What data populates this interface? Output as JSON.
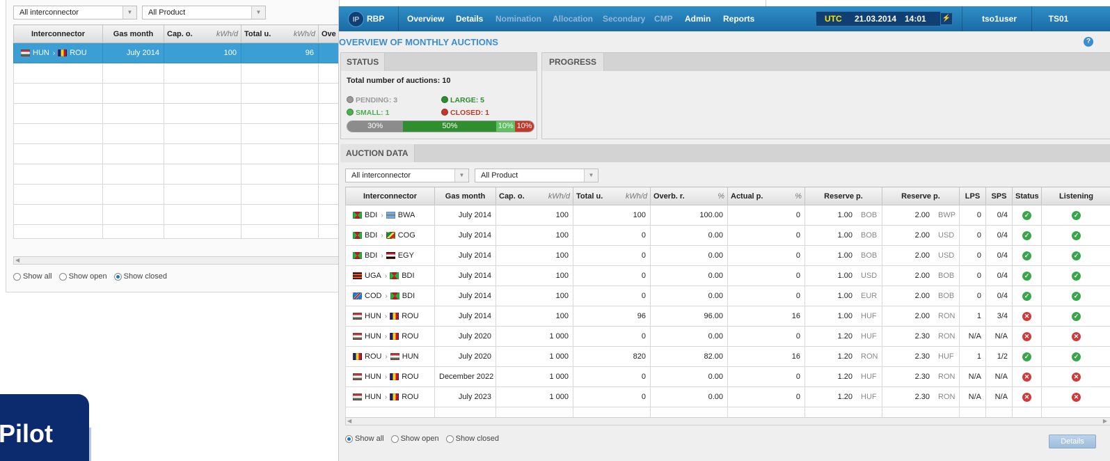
{
  "bg": {
    "filter_interconnector": "All interconnector",
    "filter_product": "All Product",
    "columns": [
      {
        "label": "Interconnector",
        "unit": ""
      },
      {
        "label": "Gas month",
        "unit": ""
      },
      {
        "label": "Cap. o.",
        "unit": "kWh/d"
      },
      {
        "label": "Total u.",
        "unit": "kWh/d"
      },
      {
        "label": "Ove",
        "unit": ""
      }
    ],
    "selected_row": {
      "from": "HUN",
      "to": "ROU",
      "month": "July 2014",
      "cap": "100",
      "total": "96"
    },
    "radio": {
      "all": "Show all",
      "open": "Show open",
      "closed": "Show closed"
    }
  },
  "brand": {
    "text": "Pilot"
  },
  "header": {
    "logo": "IP",
    "app": "RBP",
    "nav": [
      {
        "label": "Overview",
        "active": true
      },
      {
        "label": "Details",
        "active": true
      },
      {
        "label": "Nomination",
        "active": false
      },
      {
        "label": "Allocation",
        "active": false
      },
      {
        "label": "Secondary",
        "active": false
      },
      {
        "label": "CMP",
        "active": false
      },
      {
        "label": "Admin",
        "active": true
      },
      {
        "label": "Reports",
        "active": true
      }
    ],
    "utc": "UTC",
    "date": "21.03.2014",
    "time": "14:01",
    "user": "tso1user",
    "ts": "TS01"
  },
  "page": {
    "title": "OVERVIEW OF MONTHLY AUCTIONS",
    "help": "?"
  },
  "status": {
    "tab": "STATUS",
    "total": "Total number of auctions: 10",
    "pending": "PENDING: 3",
    "large": "LARGE: 5",
    "small": "SMALL: 1",
    "closed": "CLOSED: 1",
    "bar": [
      {
        "label": "30%",
        "value": 30,
        "color": "#8c8c8c"
      },
      {
        "label": "50%",
        "value": 50,
        "color": "#2f8f2f"
      },
      {
        "label": "10%",
        "value": 10,
        "color": "#5fc15f"
      },
      {
        "label": "10%",
        "value": 10,
        "color": "#c0392b"
      }
    ],
    "colors": {
      "pending": "#9a9a9a",
      "large": "#2e8b2e",
      "small": "#4caf50",
      "closed": "#c0392b"
    }
  },
  "progress": {
    "tab": "PROGRESS"
  },
  "auction": {
    "tab": "AUCTION DATA",
    "filter_interconnector": "All interconnector",
    "filter_product": "All Product",
    "columns": [
      {
        "label": "Interconnector",
        "unit": ""
      },
      {
        "label": "Gas month",
        "unit": ""
      },
      {
        "label": "Cap. o.",
        "unit": "kWh/d"
      },
      {
        "label": "Total u.",
        "unit": "kWh/d"
      },
      {
        "label": "Overb. r.",
        "unit": "%"
      },
      {
        "label": "Actual p.",
        "unit": "%"
      },
      {
        "label": "Reserve p.",
        "unit": ""
      },
      {
        "label": "Reserve p.",
        "unit": ""
      },
      {
        "label": "LPS",
        "unit": ""
      },
      {
        "label": "SPS",
        "unit": ""
      },
      {
        "label": "Status",
        "unit": ""
      },
      {
        "label": "Listening",
        "unit": ""
      }
    ],
    "rows": [
      {
        "from": "BDI",
        "to": "BWA",
        "month": "July 2014",
        "cap": "100",
        "total": "100",
        "overb": "100.00",
        "actual": "0",
        "rp1": "1.00",
        "cur1": "BOB",
        "rp2": "2.00",
        "cur2": "BWP",
        "lps": "0",
        "sps": "0/4",
        "status": "ok",
        "listening": "ok"
      },
      {
        "from": "BDI",
        "to": "COG",
        "month": "July 2014",
        "cap": "100",
        "total": "0",
        "overb": "0.00",
        "actual": "0",
        "rp1": "1.00",
        "cur1": "BOB",
        "rp2": "2.00",
        "cur2": "USD",
        "lps": "0",
        "sps": "0/4",
        "status": "ok",
        "listening": "ok"
      },
      {
        "from": "BDI",
        "to": "EGY",
        "month": "July 2014",
        "cap": "100",
        "total": "0",
        "overb": "0.00",
        "actual": "0",
        "rp1": "1.00",
        "cur1": "BOB",
        "rp2": "2.00",
        "cur2": "USD",
        "lps": "0",
        "sps": "0/4",
        "status": "ok",
        "listening": "ok"
      },
      {
        "from": "UGA",
        "to": "BDI",
        "month": "July 2014",
        "cap": "100",
        "total": "0",
        "overb": "0.00",
        "actual": "0",
        "rp1": "1.00",
        "cur1": "USD",
        "rp2": "2.00",
        "cur2": "BOB",
        "lps": "0",
        "sps": "0/4",
        "status": "ok",
        "listening": "ok"
      },
      {
        "from": "COD",
        "to": "BDI",
        "month": "July 2014",
        "cap": "100",
        "total": "0",
        "overb": "0.00",
        "actual": "0",
        "rp1": "1.00",
        "cur1": "EUR",
        "rp2": "2.00",
        "cur2": "BOB",
        "lps": "0",
        "sps": "0/4",
        "status": "ok",
        "listening": "ok"
      },
      {
        "from": "HUN",
        "to": "ROU",
        "month": "July 2014",
        "cap": "100",
        "total": "96",
        "overb": "96.00",
        "actual": "16",
        "rp1": "1.00",
        "cur1": "HUF",
        "rp2": "2.00",
        "cur2": "RON",
        "lps": "1",
        "sps": "3/4",
        "status": "err",
        "listening": "ok"
      },
      {
        "from": "HUN",
        "to": "ROU",
        "month": "July 2020",
        "cap": "1 000",
        "total": "0",
        "overb": "0.00",
        "actual": "0",
        "rp1": "1.20",
        "cur1": "HUF",
        "rp2": "2.30",
        "cur2": "RON",
        "lps": "N/A",
        "sps": "N/A",
        "status": "err",
        "listening": "err"
      },
      {
        "from": "ROU",
        "to": "HUN",
        "month": "July 2020",
        "cap": "1 000",
        "total": "820",
        "overb": "82.00",
        "actual": "16",
        "rp1": "1.20",
        "cur1": "RON",
        "rp2": "2.30",
        "cur2": "HUF",
        "lps": "1",
        "sps": "1/2",
        "status": "ok",
        "listening": "ok"
      },
      {
        "from": "HUN",
        "to": "ROU",
        "month": "December 2022",
        "cap": "1 000",
        "total": "0",
        "overb": "0.00",
        "actual": "0",
        "rp1": "1.20",
        "cur1": "HUF",
        "rp2": "2.30",
        "cur2": "RON",
        "lps": "N/A",
        "sps": "N/A",
        "status": "err",
        "listening": "err"
      },
      {
        "from": "HUN",
        "to": "ROU",
        "month": "July 2023",
        "cap": "1 000",
        "total": "0",
        "overb": "0.00",
        "actual": "0",
        "rp1": "1.20",
        "cur1": "HUF",
        "rp2": "2.30",
        "cur2": "RON",
        "lps": "N/A",
        "sps": "N/A",
        "status": "err",
        "listening": "err"
      }
    ],
    "radio": {
      "all": "Show all",
      "open": "Show open",
      "closed": "Show closed"
    },
    "details_button": "Details"
  }
}
